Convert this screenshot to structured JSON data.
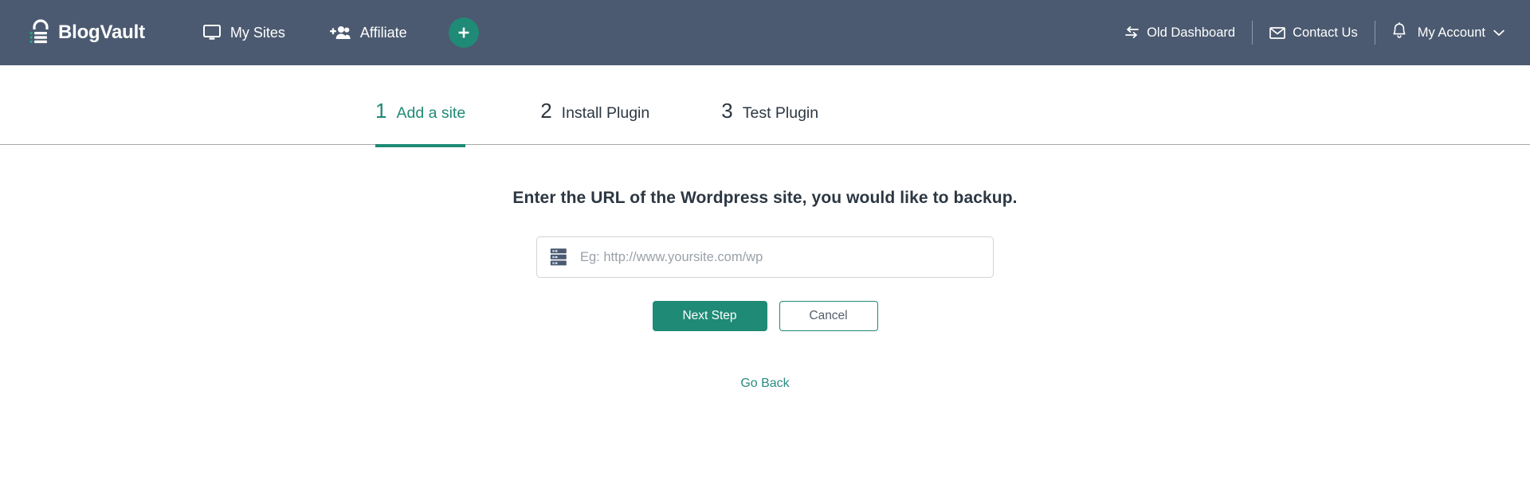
{
  "header": {
    "brand": {
      "text": "BlogVault",
      "icon": "padlock-logo-icon"
    },
    "nav_left": [
      {
        "label": "My Sites",
        "icon": "monitor-icon"
      },
      {
        "label": "Affiliate",
        "icon": "add-people-icon"
      }
    ],
    "add_button": {
      "icon": "plus-icon",
      "label": "+"
    },
    "nav_right": [
      {
        "label": "Old Dashboard",
        "icon": "swap-arrows-icon"
      },
      {
        "label": "Contact Us",
        "icon": "envelope-icon"
      }
    ],
    "notifications_icon": "bell-icon",
    "account": {
      "label": "My Account",
      "icon": "chevron-down-icon"
    }
  },
  "steps": [
    {
      "number": "1",
      "label": "Add a site",
      "active": true
    },
    {
      "number": "2",
      "label": "Install Plugin",
      "active": false
    },
    {
      "number": "3",
      "label": "Test Plugin",
      "active": false
    }
  ],
  "main": {
    "headline": "Enter the URL of the Wordpress site, you would like to backup.",
    "url_input": {
      "value": "",
      "placeholder": "Eg: http://www.yoursite.com/wp",
      "icon": "server-stack-icon"
    },
    "primary_button": "Next Step",
    "secondary_button": "Cancel",
    "go_back_link": "Go Back"
  },
  "colors": {
    "header_bg": "#4b5a70",
    "accent_teal": "#1f8a76",
    "link_teal": "#2b8b80",
    "text_dark": "#2c3742",
    "placeholder": "#9aa1a9",
    "border_gray": "#cfd4d9"
  }
}
